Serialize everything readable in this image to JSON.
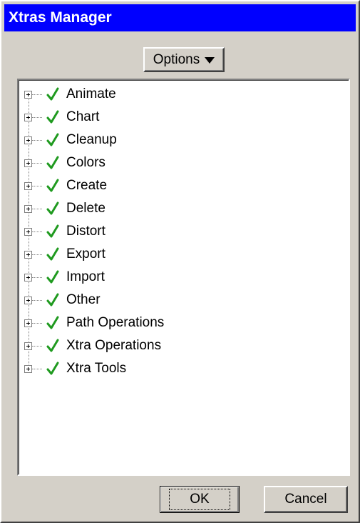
{
  "window": {
    "title": "Xtras Manager"
  },
  "toolbar": {
    "options_label": "Options"
  },
  "tree": {
    "items": [
      {
        "label": "Animate",
        "checked": true
      },
      {
        "label": "Chart",
        "checked": true
      },
      {
        "label": "Cleanup",
        "checked": true
      },
      {
        "label": "Colors",
        "checked": true
      },
      {
        "label": "Create",
        "checked": true
      },
      {
        "label": "Delete",
        "checked": true
      },
      {
        "label": "Distort",
        "checked": true
      },
      {
        "label": "Export",
        "checked": true
      },
      {
        "label": "Import",
        "checked": true
      },
      {
        "label": "Other",
        "checked": true
      },
      {
        "label": "Path Operations",
        "checked": true
      },
      {
        "label": "Xtra Operations",
        "checked": true
      },
      {
        "label": "Xtra Tools",
        "checked": true
      }
    ]
  },
  "buttons": {
    "ok_label": "OK",
    "cancel_label": "Cancel"
  },
  "icons": {
    "check": "checkmark-icon",
    "expander": "plus-expander-icon",
    "dropdown": "triangle-down-icon"
  },
  "colors": {
    "titlebar": "#0000ff",
    "check": "#1f9a1f",
    "face": "#d4d0c8"
  }
}
